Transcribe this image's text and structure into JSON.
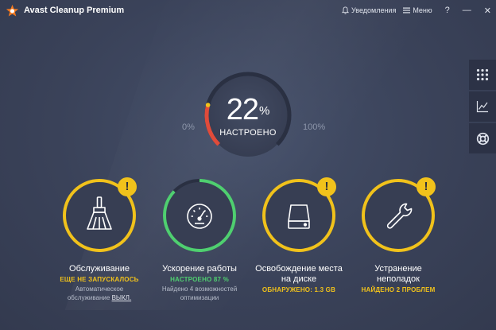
{
  "app": {
    "title": "Avast Cleanup Premium"
  },
  "titlebar": {
    "notifications_label": "Уведомления",
    "menu_label": "Меню",
    "help_label": "?",
    "minimize_label": "—",
    "close_label": "✕"
  },
  "sidebar": {
    "items": [
      {
        "icon": "grid-icon"
      },
      {
        "icon": "chart-icon"
      },
      {
        "icon": "lifebuoy-icon"
      }
    ]
  },
  "gauge": {
    "value": "22",
    "value_fraction": 0.22,
    "unit": "%",
    "status": "НАСТРОЕНО",
    "min_label": "0%",
    "max_label": "100%"
  },
  "cards": [
    {
      "title": "Обслуживание",
      "status": "ЕЩЕ НЕ ЗАПУСКАЛОСЬ",
      "sub_line1": "Автоматическое",
      "sub_line2": "обслуживание",
      "sub_link": "ВЫКЛ.",
      "icon": "broom-icon"
    },
    {
      "title": "Ускорение работы",
      "status": "НАСТРОЕНО 87 %",
      "progress_fraction": 0.87,
      "sub_line1": "Найдено 4 возможностей",
      "sub_line2": "оптимизации",
      "icon": "speedometer-icon"
    },
    {
      "title_line1": "Освобождение места",
      "title_line2": "на диске",
      "status": "ОБНАРУЖЕНО: 1.3 GB",
      "icon": "disk-icon"
    },
    {
      "title_line1": "Устранение",
      "title_line2": "неполадок",
      "status": "НАЙДЕНО 2 ПРОБЛЕМ",
      "icon": "wrench-icon"
    }
  ],
  "badge_mark": "!",
  "colors": {
    "accent_yellow": "#f1c21b",
    "accent_green": "#4fcf70",
    "gauge_red": "#e04b3a",
    "background": "#3a4259"
  }
}
